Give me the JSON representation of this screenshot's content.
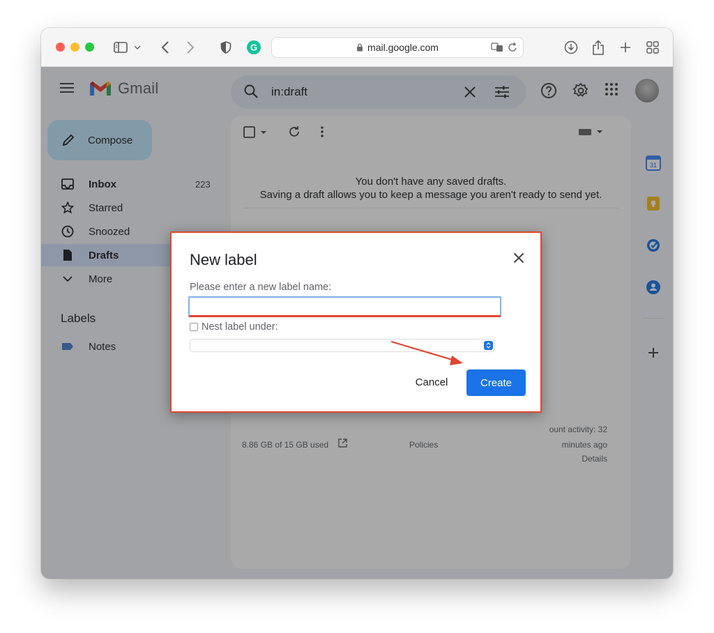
{
  "browser": {
    "url": "mail.google.com"
  },
  "gmail": {
    "logo_text": "Gmail",
    "search_query": "in:draft",
    "compose_label": "Compose",
    "nav": [
      {
        "label": "Inbox",
        "count": "223",
        "icon": "inbox-icon"
      },
      {
        "label": "Starred",
        "count": "",
        "icon": "star-icon"
      },
      {
        "label": "Snoozed",
        "count": "",
        "icon": "clock-icon"
      },
      {
        "label": "Drafts",
        "count": "",
        "icon": "draft-icon"
      },
      {
        "label": "More",
        "count": "",
        "icon": "chevron-down-icon"
      }
    ],
    "labels_title": "Labels",
    "labels": [
      {
        "label": "Notes",
        "icon": "label-icon"
      }
    ],
    "empty_line1": "You don't have any saved drafts.",
    "empty_line2": "Saving a draft allows you to keep a message you aren't ready to send yet.",
    "footer": {
      "storage": "8.86 GB of 15 GB used",
      "policies": "Policies",
      "activity_line1": "ount activity: 32",
      "activity_line2": "minutes ago",
      "details": "Details"
    }
  },
  "dialog": {
    "title": "New label",
    "prompt": "Please enter a new label name:",
    "input_value": "",
    "nest_label": "Nest label under:",
    "nest_checked": false,
    "cancel_label": "Cancel",
    "create_label": "Create"
  },
  "colors": {
    "accent_blue": "#1a73e8",
    "highlight_red": "#e0462f",
    "compose_bg": "#c2e7ff"
  }
}
